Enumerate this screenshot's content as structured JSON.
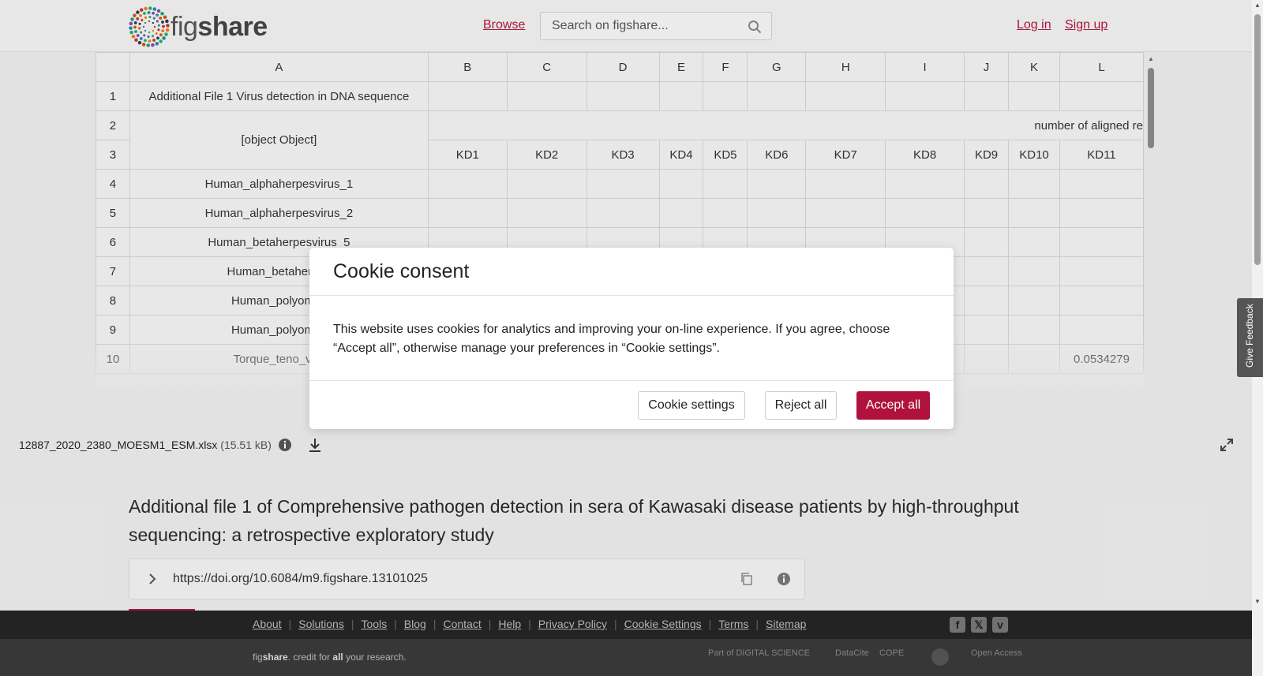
{
  "header": {
    "logo_text_a": "fig",
    "logo_text_b": "share",
    "browse": "Browse",
    "search_placeholder": "Search on figshare...",
    "login": "Log in",
    "signup": "Sign up"
  },
  "sheet": {
    "columns": [
      "",
      "A",
      "B",
      "C",
      "D",
      "E",
      "F",
      "G",
      "H",
      "I",
      "J",
      "K",
      "L"
    ],
    "row1": {
      "num": "1",
      "a": "Additional File 1 Virus detection in DNA sequence"
    },
    "row2": {
      "num": "2",
      "a": "[object Object]",
      "merged": "number of aligned re"
    },
    "row3": {
      "num": "3",
      "cells": [
        "KD1",
        "KD2",
        "KD3",
        "KD4",
        "KD5",
        "KD6",
        "KD7",
        "KD8",
        "KD9",
        "KD10",
        "KD11"
      ]
    },
    "rows": [
      {
        "num": "4",
        "a": "Human_alphaherpesvirus_1",
        "l": ""
      },
      {
        "num": "5",
        "a": "Human_alphaherpesvirus_2",
        "l": ""
      },
      {
        "num": "6",
        "a": "Human_betaherpesvirus_5",
        "l": ""
      },
      {
        "num": "7",
        "a": "Human_betaherpes",
        "l": ""
      },
      {
        "num": "8",
        "a": "Human_polyomav",
        "l": ""
      },
      {
        "num": "9",
        "a": "Human_polyomav",
        "l": ""
      },
      {
        "num": "10",
        "a": "Torque_teno_viru",
        "l": "0.0534279"
      }
    ]
  },
  "file": {
    "name": "12887_2020_2380_MOESM1_ESM.xlsx",
    "size": "(15.51 kB)"
  },
  "article": {
    "title": "Additional file 1 of Comprehensive pathogen detection in sera of Kawasaki disease patients by high-throughput sequencing: a retrospective exploratory study",
    "doi": "https://doi.org/10.6084/m9.figshare.13101025"
  },
  "footer": {
    "links": [
      "About",
      "Solutions",
      "Tools",
      "Blog",
      "Contact",
      "Help",
      "Privacy Policy",
      "Cookie Settings",
      "Terms",
      "Sitemap"
    ],
    "tagline_a": "fig",
    "tagline_b": "share",
    "tagline_c": ". credit for ",
    "tagline_d": "all",
    "tagline_e": " your research.",
    "partners": [
      "Part of DIGITAL SCIENCE",
      "DataCite",
      "COPE",
      "",
      "Open Access"
    ]
  },
  "cookie": {
    "title": "Cookie consent",
    "body": "This website uses cookies for analytics and improving your on-line experience. If you agree, choose “Accept all”, otherwise manage your preferences in “Cookie settings”.",
    "settings": "Cookie settings",
    "reject": "Reject all",
    "accept": "Accept all"
  },
  "feedback": "Give Feedback",
  "colors": {
    "brand": "#b0163f"
  }
}
